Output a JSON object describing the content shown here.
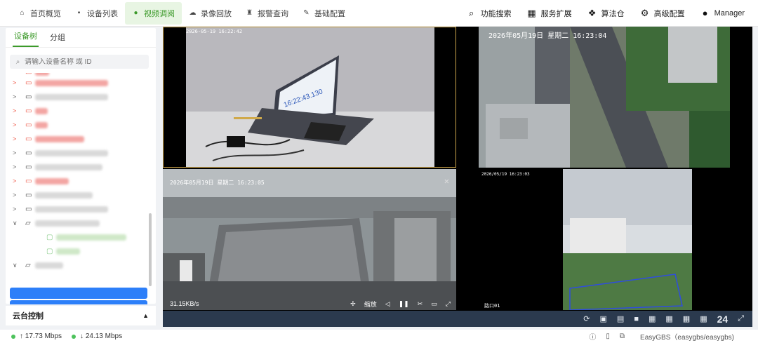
{
  "nav": {
    "items": [
      {
        "label": "首页概览",
        "icon": "home-icon",
        "glyph": "⌂"
      },
      {
        "label": "设备列表",
        "icon": "camera-icon",
        "glyph": "▪"
      },
      {
        "label": "视频调阅",
        "icon": "play-circle-icon",
        "glyph": "●"
      },
      {
        "label": "录像回放",
        "icon": "cloud-icon",
        "glyph": "☁"
      },
      {
        "label": "报警查询",
        "icon": "alarm-icon",
        "glyph": "♜"
      },
      {
        "label": "基础配置",
        "icon": "edit-icon",
        "glyph": "✎"
      }
    ],
    "active": "视频调阅",
    "right": [
      {
        "label": "功能搜索",
        "icon": "search-icon",
        "glyph": "⌕"
      },
      {
        "label": "服务扩展",
        "icon": "grid-icon",
        "glyph": "▦"
      },
      {
        "label": "算法仓",
        "icon": "dropbox-icon",
        "glyph": "❖"
      },
      {
        "label": "高级配置",
        "icon": "gear-icon",
        "glyph": "⚙"
      },
      {
        "label": "Manager",
        "icon": "user-icon",
        "glyph": "●"
      }
    ]
  },
  "sidebar": {
    "tabs": [
      "设备树",
      "分组"
    ],
    "active_tab": "设备树",
    "search_placeholder": "请输入设备名称 或 ID",
    "ptz_label": "云台控制",
    "ptz_arrow": "▲"
  },
  "videos": {
    "cell1_timestamp": "2026-05-19 16:22:42",
    "cell1_screen_time": "16:22:43.130",
    "cell2_timestamp": "2026年05月19日  星期二  16:23:04",
    "cell3_timestamp": "2026年05月19日  星期二  16:23:05",
    "cell3_bitrate": "31.15KB/s",
    "cell3_zoom": "缩放",
    "cell4_timestamp": "2026/05/19 16:23:03",
    "cell4_channel": "路口01"
  },
  "controls": {
    "window_count": "24"
  },
  "status": {
    "upload": "17.73 Mbps",
    "download": "24.13 Mbps",
    "server": "EasyGBS（easygbs/easygbs)"
  },
  "colors": {
    "accent": "#3c9a2a",
    "selection": "#2d7ff9",
    "control_bar": "#2b3a4e"
  }
}
